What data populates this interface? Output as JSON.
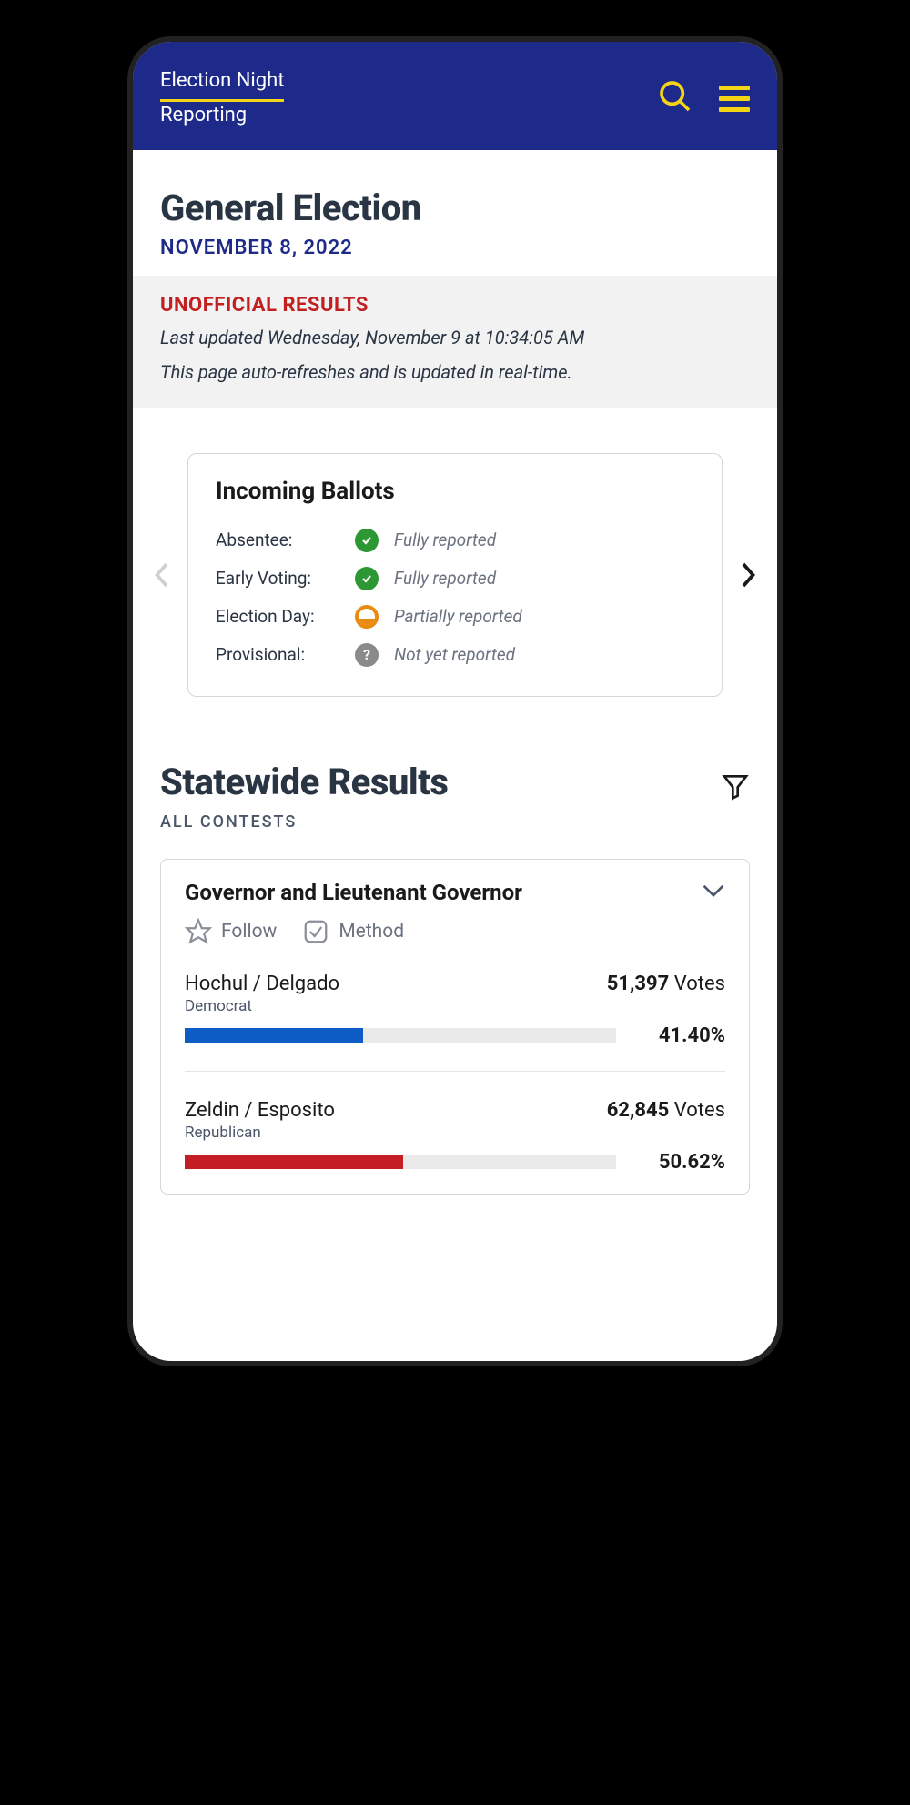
{
  "header": {
    "title_line1": "Election Night",
    "title_line2": "Reporting"
  },
  "page": {
    "title": "General Election",
    "date": "NOVEMBER 8, 2022"
  },
  "status": {
    "heading": "UNOFFICIAL RESULTS",
    "updated": "Last updated Wednesday, November 9 at 10:34:05 AM",
    "refresh": "This page auto-refreshes and is updated in real-time."
  },
  "ballots": {
    "title": "Incoming Ballots",
    "rows": [
      {
        "label": "Absentee:",
        "status": "Fully reported",
        "icon": "green-check"
      },
      {
        "label": "Early Voting:",
        "status": "Fully reported",
        "icon": "green-check"
      },
      {
        "label": "Election Day:",
        "status": "Partially reported",
        "icon": "partial"
      },
      {
        "label": "Provisional:",
        "status": "Not yet reported",
        "icon": "question"
      }
    ]
  },
  "results": {
    "title": "Statewide Results",
    "subtitle": "ALL CONTESTS"
  },
  "contest": {
    "title": "Governor and Lieutenant Governor",
    "follow_label": "Follow",
    "method_label": "Method",
    "votes_suffix": "Votes",
    "candidates": [
      {
        "name": "Hochul / Delgado",
        "party": "Democrat",
        "votes": "51,397",
        "pct": "41.40%",
        "bar_width": "41.40%",
        "color": "blue"
      },
      {
        "name": "Zeldin / Esposito",
        "party": "Republican",
        "votes": "62,845",
        "pct": "50.62%",
        "bar_width": "50.62%",
        "color": "red"
      }
    ]
  },
  "colors": {
    "header_bg": "#1e2a8a",
    "accent_yellow": "#f5d415",
    "alert_red": "#c22020",
    "dem_blue": "#0d5bc4",
    "rep_red": "#c41e24"
  }
}
